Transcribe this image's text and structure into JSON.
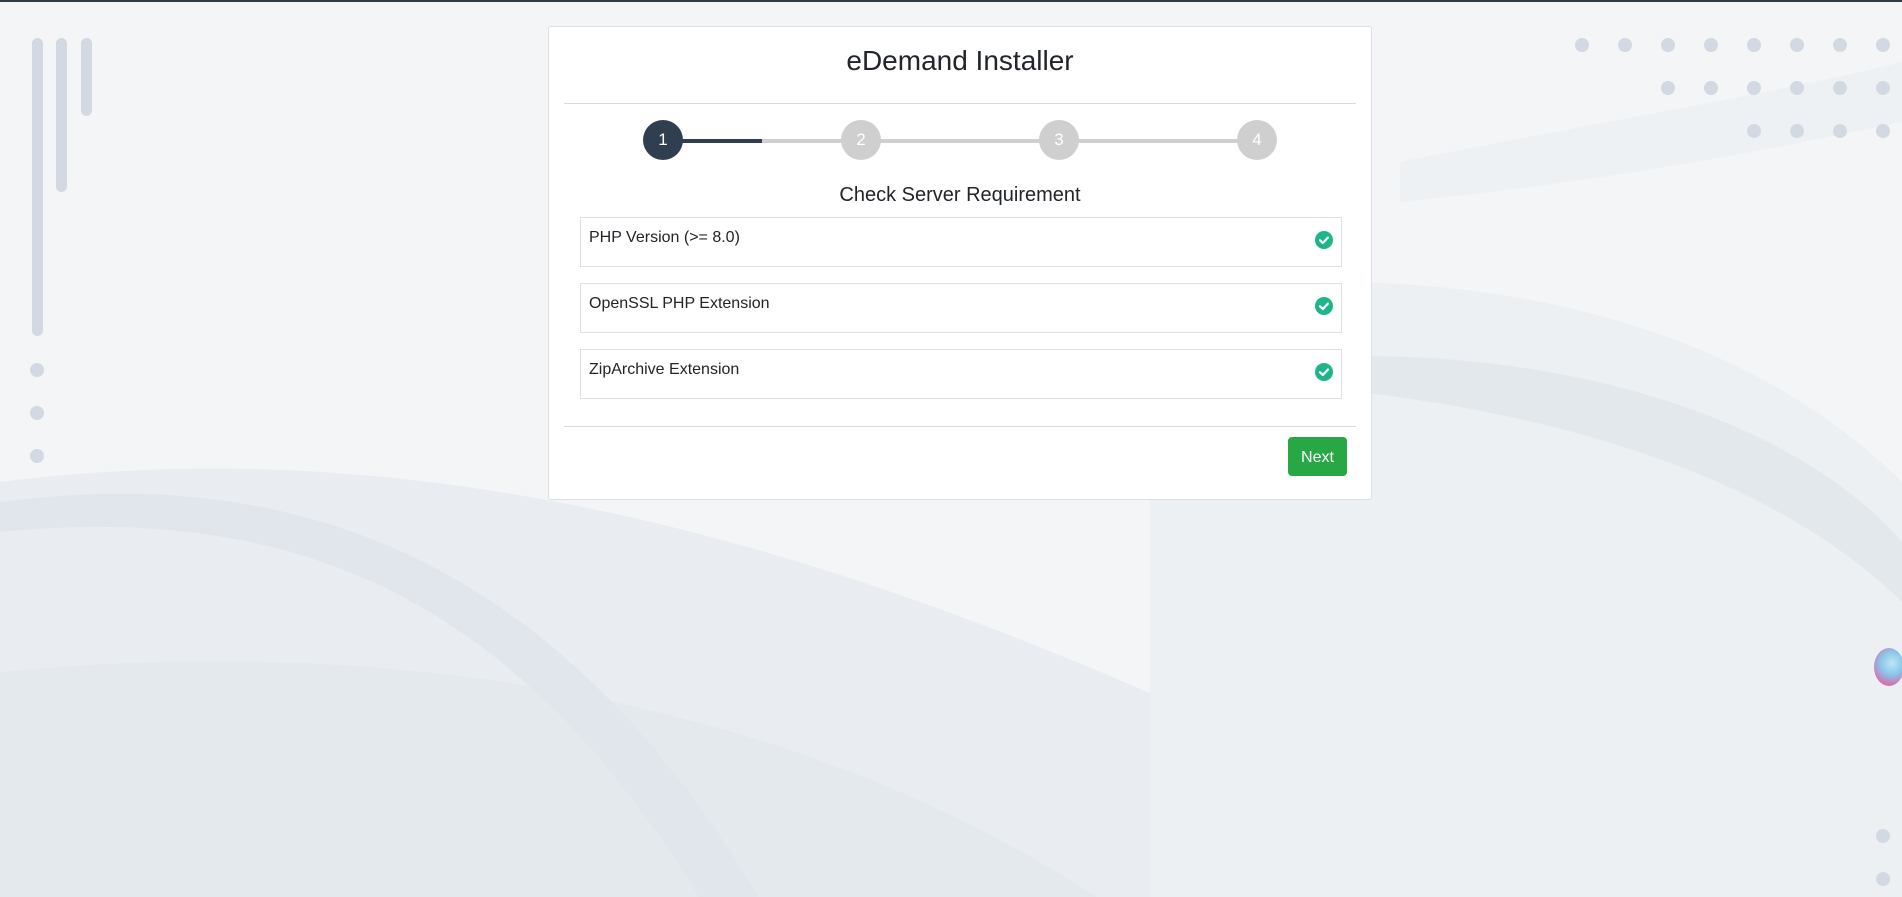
{
  "installer": {
    "title": "eDemand Installer",
    "steps": [
      "1",
      "2",
      "3",
      "4"
    ],
    "active_step": 1,
    "section_title": "Check Server Requirement",
    "requirements": [
      {
        "label": "PHP Version (>= 8.0)",
        "status": "passed",
        "icon": "check-circle-icon"
      },
      {
        "label": "OpenSSL PHP Extension",
        "status": "passed",
        "icon": "check-circle-icon"
      },
      {
        "label": "ZipArchive Extension",
        "status": "passed",
        "icon": "check-circle-icon"
      }
    ],
    "next_label": "Next"
  },
  "colors": {
    "active_step": "#2f3f50",
    "inactive_step": "#cfcfcf",
    "check": "#1fb58a",
    "next_button": "#28a745",
    "background": "#f3f5f7"
  }
}
